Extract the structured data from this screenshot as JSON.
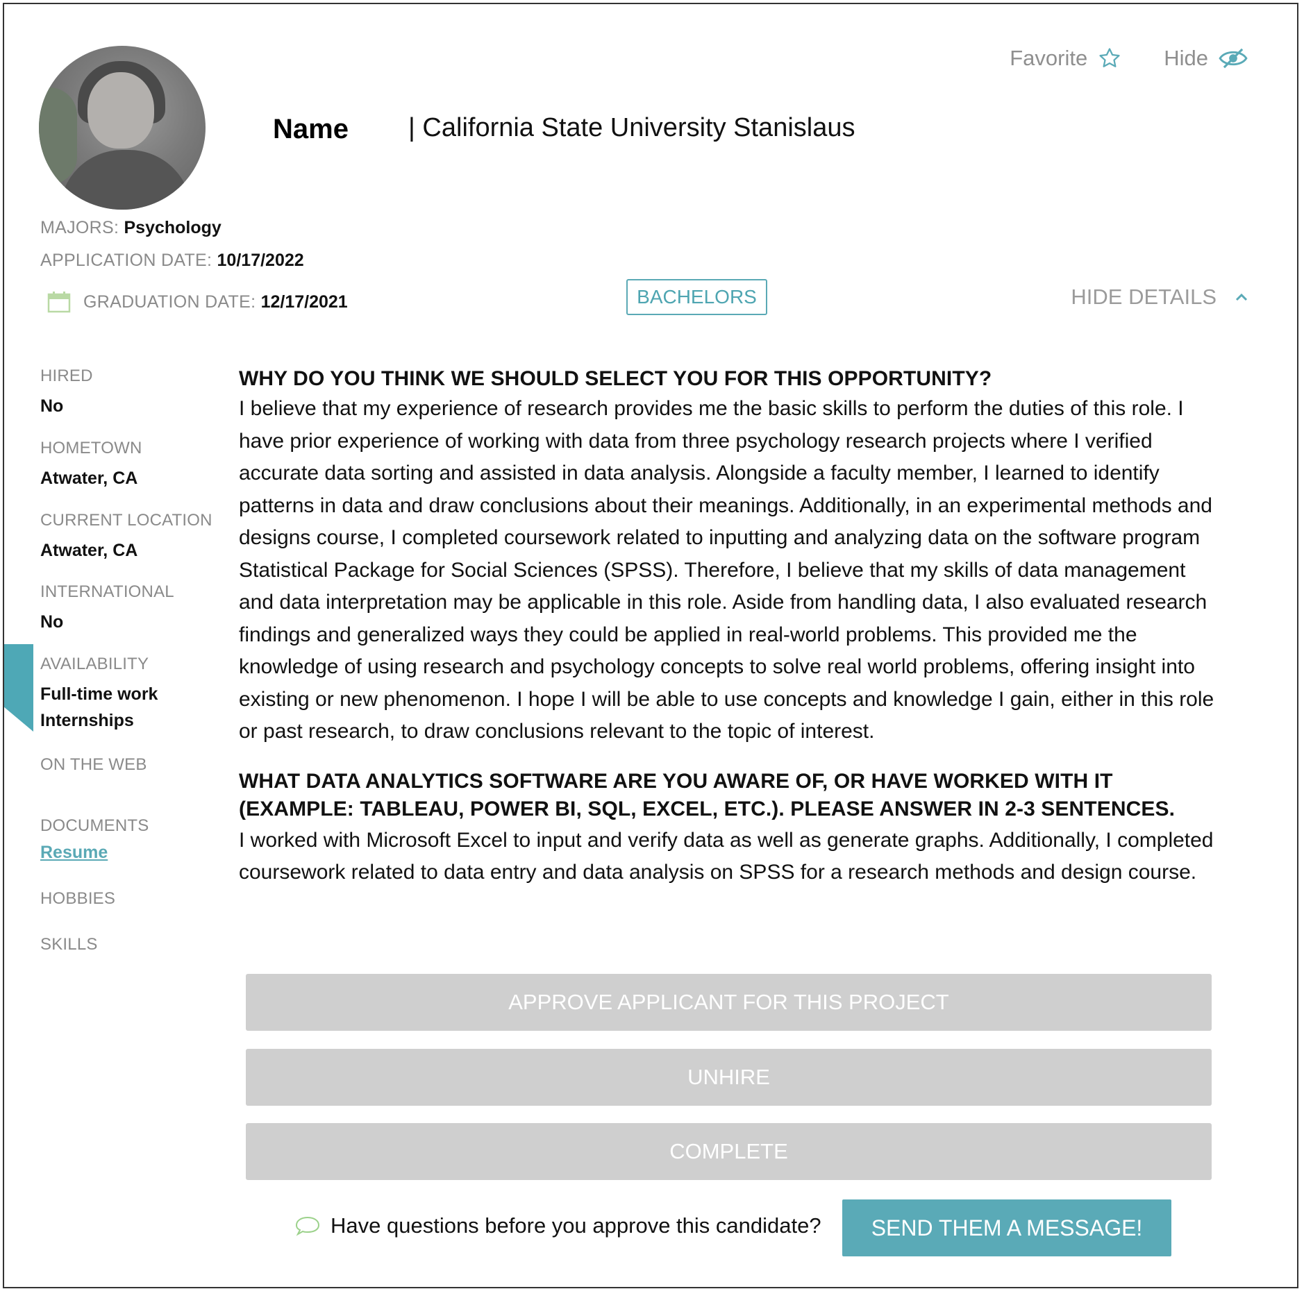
{
  "header": {
    "name_label": "Name",
    "school": "| California State University Stanislaus",
    "favorite_label": "Favorite",
    "hide_label": "Hide"
  },
  "meta": {
    "majors_label": "MAJORS:",
    "majors_value": "Psychology",
    "application_date_label": "APPLICATION DATE:",
    "application_date_value": "10/17/2022",
    "graduation_date_label": "GRADUATION DATE:",
    "graduation_date_value": "12/17/2021",
    "degree_badge": "BACHELORS",
    "hide_details_label": "HIDE DETAILS"
  },
  "sidebar": {
    "hired_label": "HIRED",
    "hired_value": "No",
    "hometown_label": "HOMETOWN",
    "hometown_value": "Atwater, CA",
    "current_location_label": "CURRENT LOCATION",
    "current_location_value": "Atwater, CA",
    "international_label": "INTERNATIONAL",
    "international_value": "No",
    "availability_label": "AVAILABILITY",
    "availability_values": [
      "Full-time work",
      "Internships"
    ],
    "on_the_web_label": "ON THE WEB",
    "documents_label": "DOCUMENTS",
    "resume_link": "Resume",
    "hobbies_label": "HOBBIES",
    "skills_label": "SKILLS"
  },
  "questions": [
    {
      "title": "WHY DO YOU THINK WE SHOULD SELECT YOU FOR THIS OPPORTUNITY?",
      "answer": "I believe that my experience of research provides me the basic skills to perform the duties of this role. I have prior experience of working with data from three psychology research projects where I verified accurate data sorting and assisted in data analysis. Alongside a faculty member, I learned to identify patterns in data and draw conclusions about their meanings. Additionally, in an experimental methods and designs course, I completed coursework related to inputting and analyzing data on the software program Statistical Package for Social Sciences (SPSS). Therefore, I believe that my skills of data management and data interpretation may be applicable in this role. Aside from handling data, I also evaluated research findings and generalized ways they could be applied in real-world problems. This provided me the knowledge of using research and psychology concepts to solve real world problems, offering insight into existing or new phenomenon. I hope I will be able to use concepts and knowledge I gain, either in this role or past research, to draw conclusions relevant to the topic of interest."
    },
    {
      "title": "WHAT DATA ANALYTICS SOFTWARE ARE YOU AWARE OF, OR HAVE WORKED WITH IT (EXAMPLE: TABLEAU, POWER BI, SQL, EXCEL, ETC.). PLEASE ANSWER IN 2-3 SENTENCES.",
      "answer": "I worked with Microsoft Excel to input and verify data as well as generate graphs. Additionally, I completed coursework related to data entry and data analysis on SPSS for a research methods and design course."
    }
  ],
  "actions": {
    "approve_label": "APPROVE APPLICANT FOR THIS PROJECT",
    "unhire_label": "UNHIRE",
    "complete_label": "COMPLETE",
    "question_prompt": "Have questions before you approve this candidate?",
    "message_button_label": "SEND THEM A MESSAGE!"
  },
  "icons": {
    "favorite": "star-outline-icon",
    "hide": "eye-slash-icon",
    "calendar": "calendar-icon",
    "chevron": "chevron-up-icon",
    "chat": "chat-bubble-icon"
  },
  "colors": {
    "accent": "#5aaab7",
    "muted_text": "#8a8a8a",
    "disabled_button": "#cfcfcf"
  }
}
